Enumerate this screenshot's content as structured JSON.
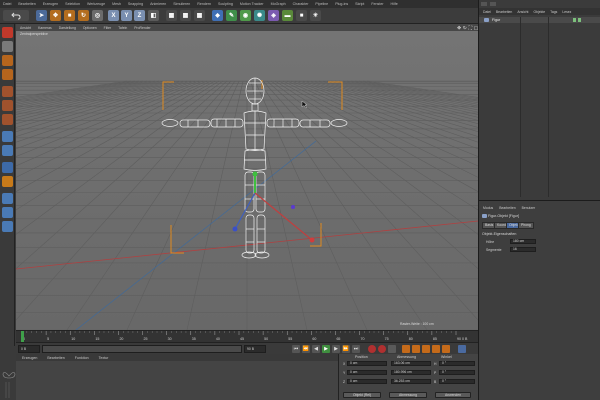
{
  "menubar": {
    "items": [
      "Datei",
      "Bearbeiten",
      "Erzeugen",
      "Selektion",
      "Werkzeuge",
      "Mesh",
      "Snapping",
      "Animieren",
      "Simulieren",
      "Rendern",
      "Sculpting",
      "Motion Tracker",
      "MoGraph",
      "Charakter",
      "Pipeline",
      "Plug-ins",
      "Skript",
      "Fenster",
      "Hilfe"
    ]
  },
  "toolbar": {
    "axis_x": "X",
    "axis_y": "Y",
    "axis_z": "Z"
  },
  "viewport": {
    "menu": [
      "Ansicht",
      "Kameras",
      "Darstellung",
      "Optionen",
      "Filter",
      "Tafeln",
      "ProRender"
    ],
    "label": "Zentralperspektive",
    "info": "Raster-Weite : 100 cm"
  },
  "timeline": {
    "ticks": [
      "0",
      "5",
      "10",
      "15",
      "20",
      "25",
      "30",
      "35",
      "40",
      "45",
      "50",
      "55",
      "60",
      "65",
      "70",
      "75",
      "80",
      "85",
      "90"
    ],
    "end_frame": "0 B",
    "start_field": "0 B",
    "current_field": "0 B",
    "end_field": "90 B",
    "end_field2": "90 B"
  },
  "materials": {
    "menu": [
      "Erzeugen",
      "Bearbeiten",
      "Funktion",
      "Textur"
    ]
  },
  "coords": {
    "headers": [
      "Position",
      "Abmessung",
      "Winkel"
    ],
    "rows": [
      {
        "axis": "X",
        "pos": "0 cm",
        "size": "163.06 cm",
        "rot_axis": "H",
        "rot": "0 °"
      },
      {
        "axis": "Y",
        "pos": "0 cm",
        "size": "180.996 cm",
        "rot_axis": "P",
        "rot": "0 °"
      },
      {
        "axis": "Z",
        "pos": "0 cm",
        "size": "36.253 cm",
        "rot_axis": "B",
        "rot": "0 °"
      }
    ],
    "mode_select": "Objekt (Rel)",
    "size_select": "Abmessung",
    "apply_button": "Anwenden"
  },
  "object_manager": {
    "menu": [
      "Datei",
      "Bearbeiten",
      "Ansicht",
      "Objekte",
      "Tags",
      "Lesez"
    ],
    "object_name": "Figur"
  },
  "attributes": {
    "menu": [
      "Modus",
      "Bearbeiten",
      "Benutzer"
    ],
    "title": "Figur-Objekt [Figur]",
    "tabs": [
      "Basis",
      "Koord.",
      "Objekt",
      "Phong"
    ],
    "section": "Objekt-Eigenschaften",
    "fields": [
      {
        "label": "Höhe",
        "value": "180 cm"
      },
      {
        "label": "Segmente",
        "value": "16"
      }
    ]
  },
  "colors": {
    "viewport_bg": "#6e6e6e",
    "grid": "#5a5a5a",
    "selection_orange": "#e08a1e",
    "accent_blue": "#5a8fd0"
  }
}
